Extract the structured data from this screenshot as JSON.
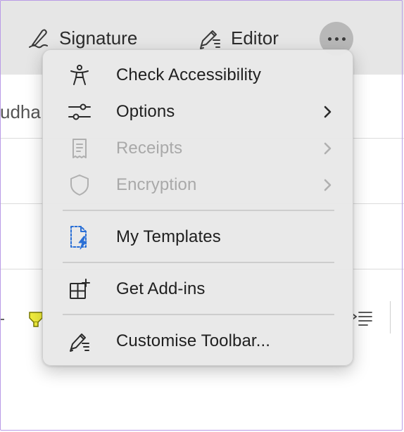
{
  "toolbar": {
    "signature_label": "Signature",
    "editor_label": "Editor",
    "more_icon": "ellipsis-icon"
  },
  "document": {
    "visible_text_fragment": "udha",
    "highlight_color": "#f2ee3d"
  },
  "menu": {
    "items": [
      {
        "label": "Check Accessibility",
        "icon": "accessibility-icon",
        "enabled": true,
        "submenu": false
      },
      {
        "label": "Options",
        "icon": "sliders-icon",
        "enabled": true,
        "submenu": true
      },
      {
        "label": "Receipts",
        "icon": "receipt-icon",
        "enabled": false,
        "submenu": true
      },
      {
        "label": "Encryption",
        "icon": "shield-icon",
        "enabled": false,
        "submenu": true
      },
      {
        "label": "My Templates",
        "icon": "templates-icon",
        "enabled": true,
        "submenu": false
      },
      {
        "label": "Get Add-ins",
        "icon": "add-ins-icon",
        "enabled": true,
        "submenu": false
      },
      {
        "label": "Customise Toolbar...",
        "icon": "pen-icon",
        "enabled": true,
        "submenu": false
      }
    ]
  },
  "colors": {
    "template_accent": "#2a6fd6",
    "disabled_text": "#a9a9a9",
    "frame_border": "#b99be6"
  }
}
